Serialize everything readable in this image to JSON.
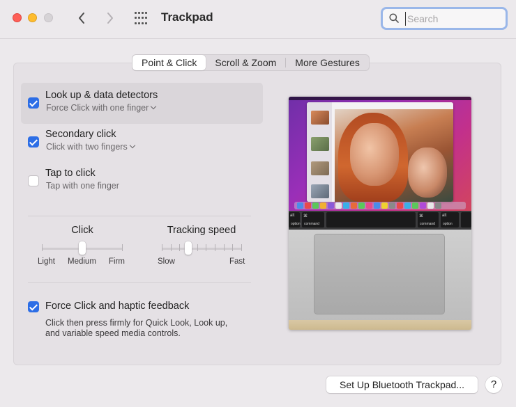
{
  "window": {
    "title": "Trackpad",
    "search_placeholder": "Search"
  },
  "icons": {
    "back": "chevron-left-icon",
    "forward": "chevron-right-icon",
    "grid": "grid-icon",
    "search": "search-icon"
  },
  "tabs": [
    {
      "label": "Point & Click",
      "active": true
    },
    {
      "label": "Scroll & Zoom",
      "active": false
    },
    {
      "label": "More Gestures",
      "active": false
    }
  ],
  "options": [
    {
      "title": "Look up & data detectors",
      "subtitle": "Force Click with one finger",
      "checked": true,
      "dropdown": true,
      "selected": true
    },
    {
      "title": "Secondary click",
      "subtitle": "Click with two fingers",
      "checked": true,
      "dropdown": true,
      "selected": false
    },
    {
      "title": "Tap to click",
      "subtitle": "Tap with one finger",
      "checked": false,
      "dropdown": false,
      "selected": false
    }
  ],
  "click_slider": {
    "label": "Click",
    "ticks": [
      "Light",
      "Medium",
      "Firm"
    ],
    "tick_count": 3,
    "value_index": 1
  },
  "tracking_slider": {
    "label": "Tracking speed",
    "min_label": "Slow",
    "max_label": "Fast",
    "tick_count": 10,
    "value_index": 3
  },
  "force_click": {
    "title": "Force Click and haptic feedback",
    "checked": true,
    "description_line1": "Click then press firmly for Quick Look, Look up,",
    "description_line2": "and variable speed media controls."
  },
  "preview_keys": {
    "option_left": "option",
    "command_left": "command",
    "command_right": "command",
    "option_right": "option",
    "cmd_symbol": "⌘",
    "opt_symbol": "alt"
  },
  "buttons": {
    "bluetooth": "Set Up Bluetooth Trackpad...",
    "help": "?"
  },
  "colors": {
    "accent": "#2d6ee6",
    "focus_ring": "#9ab7e9"
  }
}
